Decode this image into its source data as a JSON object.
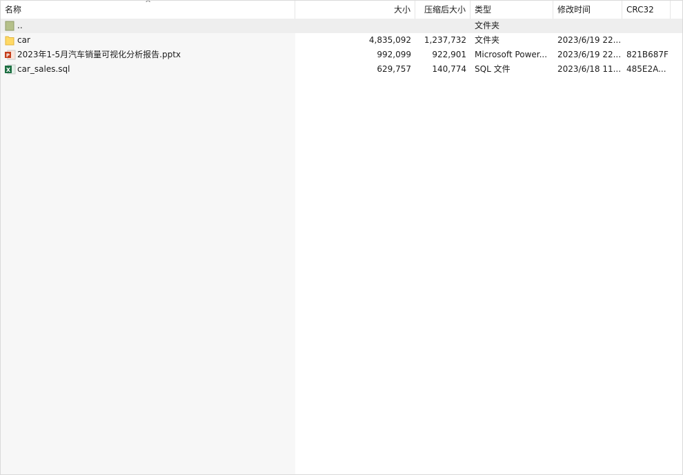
{
  "columns": {
    "name": "名称",
    "size": "大小",
    "compressed": "压缩后大小",
    "type": "类型",
    "modified": "修改时间",
    "crc": "CRC32"
  },
  "sort_indicator": "^",
  "rows": [
    {
      "name": "..",
      "size": "",
      "compressed": "",
      "type": "文件夹",
      "modified": "",
      "crc": "",
      "icon": "parent-folder-icon"
    },
    {
      "name": "car",
      "size": "4,835,092",
      "compressed": "1,237,732",
      "type": "文件夹",
      "modified": "2023/6/19 22...",
      "crc": "",
      "icon": "folder-icon"
    },
    {
      "name": "2023年1-5月汽车销量可视化分析报告.pptx",
      "size": "992,099",
      "compressed": "922,901",
      "type": "Microsoft Power...",
      "modified": "2023/6/19 22...",
      "crc": "821B687F",
      "icon": "powerpoint-file-icon"
    },
    {
      "name": "car_sales.sql",
      "size": "629,757",
      "compressed": "140,774",
      "type": "SQL 文件",
      "modified": "2023/6/18 11...",
      "crc": "485E2A...",
      "icon": "excel-file-icon"
    }
  ],
  "colors": {
    "folder": "#ffd966",
    "parent_folder": "#b5c08a",
    "powerpoint": "#c43e1c",
    "excel": "#1d6f42"
  }
}
